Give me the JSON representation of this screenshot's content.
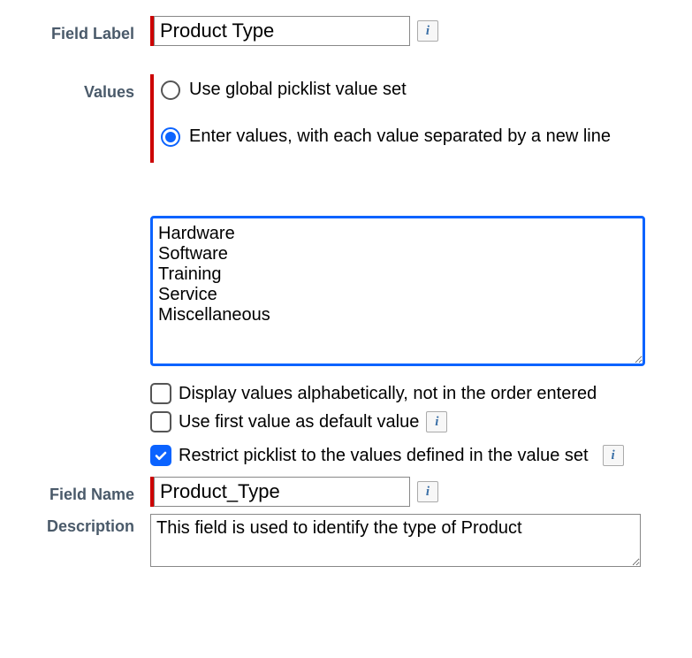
{
  "labels": {
    "field_label": "Field Label",
    "values": "Values",
    "field_name": "Field Name",
    "description": "Description"
  },
  "field_label_value": "Product Type",
  "field_name_value": "Product_Type",
  "description_value": "This field is used to identify the type of Product",
  "values_radio": {
    "global": {
      "label": "Use global picklist value set",
      "selected": false
    },
    "enter": {
      "label": "Enter values, with each value separated by a new line",
      "selected": true
    }
  },
  "values_textarea": "Hardware\nSoftware\nTraining\nService\nMiscellaneous",
  "checkboxes": {
    "alpha": {
      "label": "Display values alphabetically, not in the order entered",
      "checked": false
    },
    "default": {
      "label": "Use first value as default value",
      "checked": false
    },
    "restrict": {
      "label": "Restrict picklist to the values defined in the value set",
      "checked": true
    }
  },
  "icons": {
    "info": "i"
  }
}
